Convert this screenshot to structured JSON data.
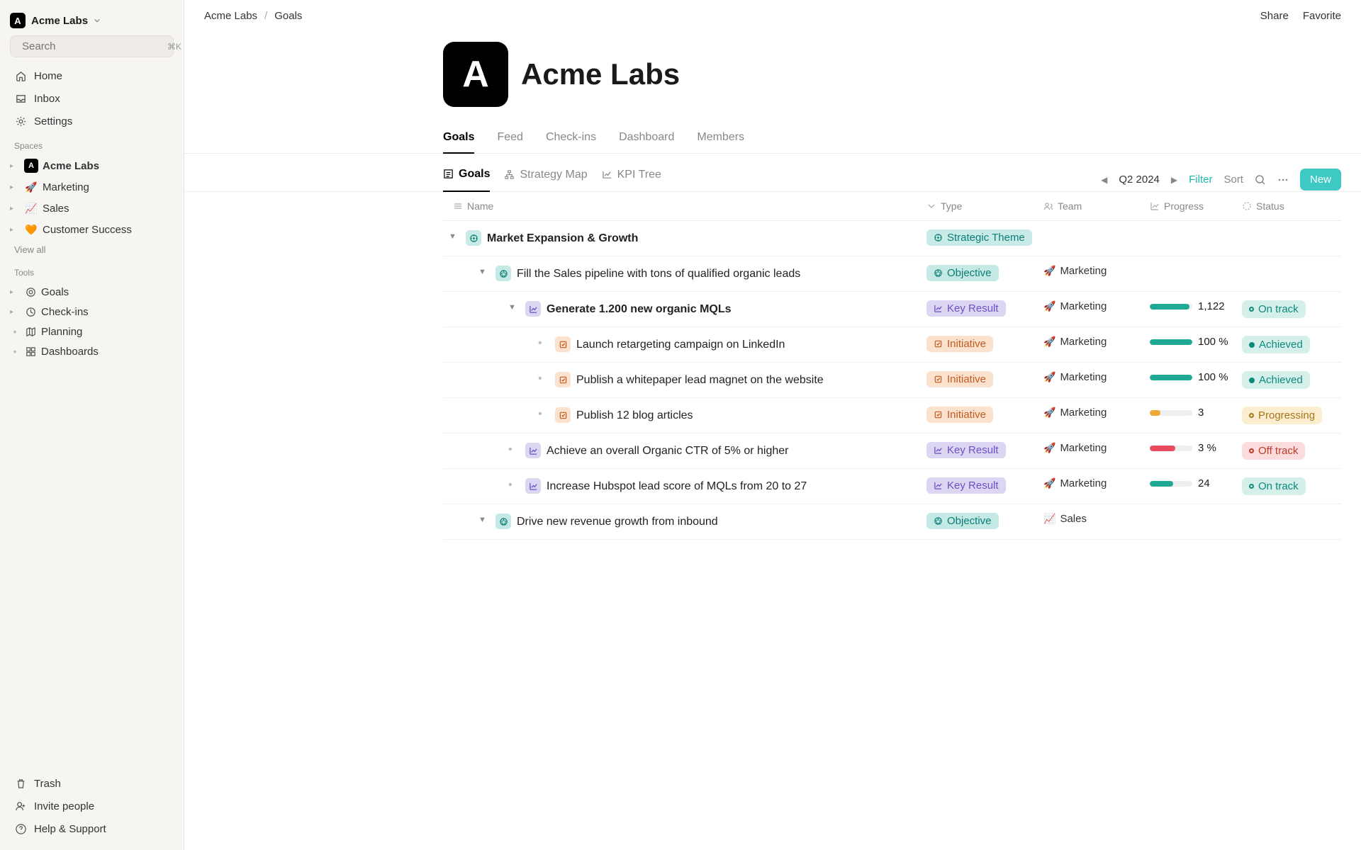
{
  "workspace": {
    "name": "Acme Labs",
    "logo_letter": "A"
  },
  "search": {
    "placeholder": "Search",
    "shortcut": "⌘K"
  },
  "nav_primary": [
    {
      "label": "Home",
      "icon": "home"
    },
    {
      "label": "Inbox",
      "icon": "inbox"
    },
    {
      "label": "Settings",
      "icon": "gear"
    }
  ],
  "section_spaces_label": "Spaces",
  "spaces": [
    {
      "label": "Acme Labs",
      "kind": "logo",
      "bold": true
    },
    {
      "label": "Marketing",
      "kind": "emoji",
      "emoji": "🚀"
    },
    {
      "label": "Sales",
      "kind": "emoji",
      "emoji": "📈"
    },
    {
      "label": "Customer Success",
      "kind": "emoji",
      "emoji": "🧡"
    }
  ],
  "view_all_label": "View all",
  "section_tools_label": "Tools",
  "tools": [
    {
      "label": "Goals",
      "icon": "target",
      "expandable": true
    },
    {
      "label": "Check-ins",
      "icon": "clock",
      "expandable": true
    },
    {
      "label": "Planning",
      "icon": "map",
      "expandable": false
    },
    {
      "label": "Dashboards",
      "icon": "grid",
      "expandable": false
    }
  ],
  "sidebar_footer": [
    {
      "label": "Trash",
      "icon": "trash"
    },
    {
      "label": "Invite people",
      "icon": "person-plus"
    },
    {
      "label": "Help & Support",
      "icon": "help"
    }
  ],
  "breadcrumb": {
    "root": "Acme Labs",
    "current": "Goals"
  },
  "top_actions": {
    "share": "Share",
    "favorite": "Favorite"
  },
  "page_title": "Acme Labs",
  "main_tabs": [
    {
      "label": "Goals",
      "active": true
    },
    {
      "label": "Feed"
    },
    {
      "label": "Check-ins"
    },
    {
      "label": "Dashboard"
    },
    {
      "label": "Members"
    }
  ],
  "view_tabs": [
    {
      "label": "Goals",
      "icon": "list",
      "active": true
    },
    {
      "label": "Strategy Map",
      "icon": "sitemap"
    },
    {
      "label": "KPI Tree",
      "icon": "tree"
    }
  ],
  "period": "Q2 2024",
  "controls": {
    "filter": "Filter",
    "sort": "Sort",
    "new": "New"
  },
  "columns": {
    "name": "Name",
    "type": "Type",
    "team": "Team",
    "progress": "Progress",
    "status": "Status"
  },
  "type_labels": {
    "strategic": "Strategic Theme",
    "objective": "Objective",
    "kr": "Key Result",
    "initiative": "Initiative"
  },
  "teams": {
    "marketing": "Marketing",
    "sales": "Sales"
  },
  "status_labels": {
    "on_track": "On track",
    "achieved": "Achieved",
    "progressing": "Progressing",
    "off_track": "Off track"
  },
  "rows": [
    {
      "indent": 0,
      "disclosure": true,
      "icon": "theme",
      "text": "Market Expansion & Growth",
      "bold": true,
      "type": "strategic"
    },
    {
      "indent": 1,
      "disclosure": true,
      "icon": "obj",
      "text": "Fill the Sales pipeline with tons of qualified organic leads",
      "type": "objective",
      "team": "marketing"
    },
    {
      "indent": 2,
      "disclosure": true,
      "icon": "kr",
      "text": "Generate 1.200 new organic MQLs",
      "bold": true,
      "type": "kr",
      "team": "marketing",
      "progress": {
        "pct": 94,
        "color": "green",
        "label": "1,122"
      },
      "status": "on_track"
    },
    {
      "indent": 3,
      "bullet": true,
      "icon": "init",
      "text": "Launch retargeting campaign on LinkedIn",
      "type": "initiative",
      "team": "marketing",
      "progress": {
        "pct": 100,
        "color": "green",
        "label": "100 %"
      },
      "status": "achieved"
    },
    {
      "indent": 3,
      "bullet": true,
      "icon": "init",
      "text": "Publish a whitepaper lead magnet on the website",
      "type": "initiative",
      "team": "marketing",
      "progress": {
        "pct": 100,
        "color": "green",
        "label": "100 %"
      },
      "status": "achieved"
    },
    {
      "indent": 3,
      "bullet": true,
      "icon": "init",
      "text": "Publish 12 blog articles",
      "type": "initiative",
      "team": "marketing",
      "progress": {
        "pct": 25,
        "color": "amber",
        "label": "3"
      },
      "status": "progressing"
    },
    {
      "indent": 2,
      "bullet": true,
      "icon": "kr",
      "text": "Achieve an overall Organic CTR of 5% or higher",
      "type": "kr",
      "team": "marketing",
      "progress": {
        "pct": 60,
        "color": "red",
        "label": "3 %"
      },
      "status": "off_track"
    },
    {
      "indent": 2,
      "bullet": true,
      "icon": "kr",
      "text": "Increase Hubspot lead score of MQLs from 20 to 27",
      "type": "kr",
      "team": "marketing",
      "progress": {
        "pct": 55,
        "color": "green",
        "label": "24"
      },
      "status": "on_track"
    },
    {
      "indent": 1,
      "disclosure": true,
      "icon": "obj",
      "text": "Drive new revenue growth from inbound",
      "type": "objective",
      "team": "sales"
    }
  ]
}
